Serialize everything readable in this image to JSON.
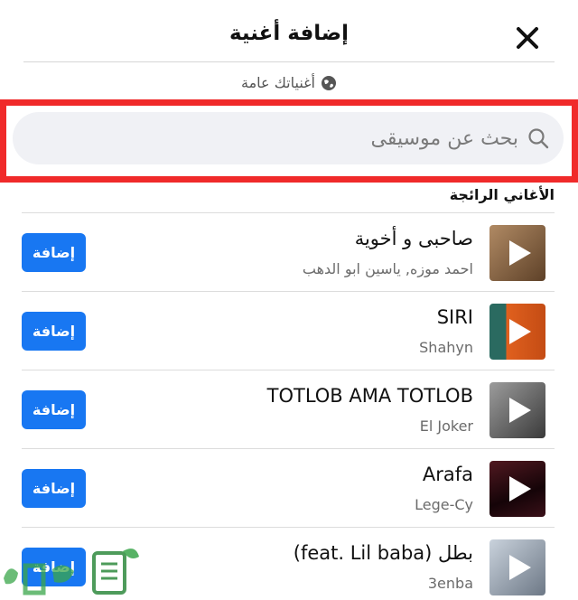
{
  "header": {
    "title": "إضافة أغنية"
  },
  "privacy": {
    "label": "أغنياتك عامة"
  },
  "search": {
    "placeholder": "بحث عن موسيقى"
  },
  "section": {
    "title": "الأغاني الرائجة"
  },
  "songs": [
    {
      "title": "صاحبى و أخوية",
      "artist": "احمد موزه, ياسين ابو الدهب",
      "add_label": "إضافة",
      "thumb_color": "#8a6a4a"
    },
    {
      "title": "SIRI",
      "artist": "Shahyn",
      "add_label": "إضافة",
      "thumb_color": "#d9591c"
    },
    {
      "title": "TOTLOB AMA TOTLOB",
      "artist": "El Joker",
      "add_label": "إضافة",
      "thumb_color": "#6d6d6d"
    },
    {
      "title": "Arafa",
      "artist": "Lege-Cy",
      "add_label": "إضافة",
      "thumb_color": "#2a0c10"
    },
    {
      "title": "بطل (feat. Lil baba)",
      "artist": "3enba",
      "add_label": "إضافة",
      "thumb_color": "#9aa6b4"
    }
  ],
  "colors": {
    "accent": "#1877f2",
    "highlight": "#f02a2a",
    "search_bg": "#f0f1f5"
  },
  "icons": {
    "close": "close-icon",
    "globe": "globe-icon",
    "search": "search-icon",
    "play": "play-icon"
  }
}
